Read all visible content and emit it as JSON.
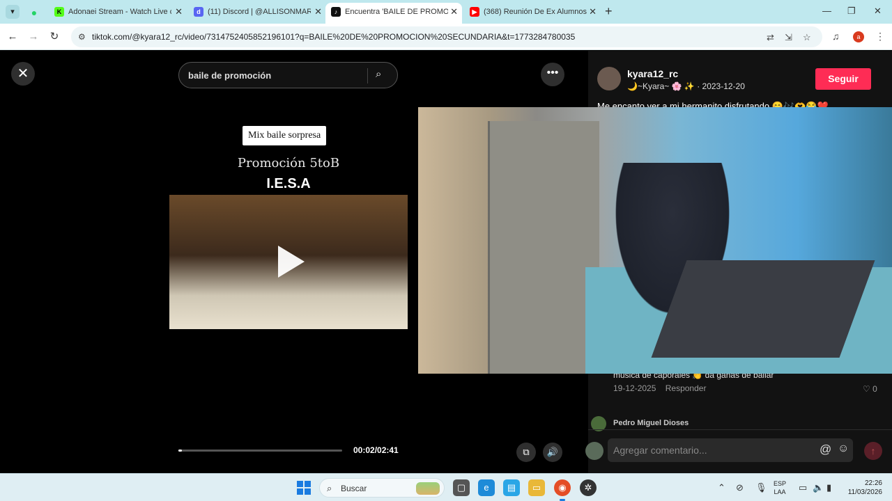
{
  "browser": {
    "pinned_icon": "whatsapp-icon",
    "tabs": [
      {
        "label": "Adonaei Stream - Watch Live c",
        "icon": "kick-icon",
        "color": "#53fc18",
        "glyph": "K"
      },
      {
        "label": "(11) Discord | @ALLISONMARIA",
        "icon": "discord-icon",
        "color": "#5865f2",
        "glyph": "11"
      },
      {
        "label": "Encuentra 'BAILE DE PROMOCI",
        "icon": "tiktok-icon",
        "color": "#111111",
        "glyph": "♪",
        "active": true
      },
      {
        "label": "(368) Reunión De Ex Alumnos -",
        "icon": "youtube-icon",
        "color": "#ff0000",
        "glyph": "▶"
      }
    ],
    "url": "tiktok.com/@kyara12_rc/video/7314752405852196101?q=BAILE%20DE%20PROMOCION%20SECUNDARIA&t=1773284780035",
    "profile_letter": "a"
  },
  "tiktok": {
    "search_query": "baile de promoción",
    "sticker_text": "Mix baile sorpresa",
    "promo_text": "Promoción 5toB",
    "school_text": "I.E.S.A",
    "progress": 0.014,
    "time": "00:02/02:41",
    "author": "kyara12_rc",
    "nickname": "🌙~Kyara~ 🌸 ✨ · 2023-12-20",
    "follow_label": "Seguir",
    "caption": "Me encanto ver a mi hermanito disfrutando 😊🎶🫶😂❤️",
    "comment": {
      "text": "musica de caporales 👏 da ganas de bailar",
      "date": "19-12-2025",
      "reply_label": "Responder",
      "likes": "0"
    },
    "comment2_author": "Pedro Miguel Dioses",
    "comment_placeholder": "Agregar comentario...",
    "at_symbol": "@",
    "close_symbol": "✕",
    "more_symbol": "•••"
  },
  "taskbar": {
    "search_label": "Buscar",
    "lang_line1": "ESP",
    "lang_line2": "LAA",
    "time": "22:26",
    "date": "11/03/2026"
  }
}
